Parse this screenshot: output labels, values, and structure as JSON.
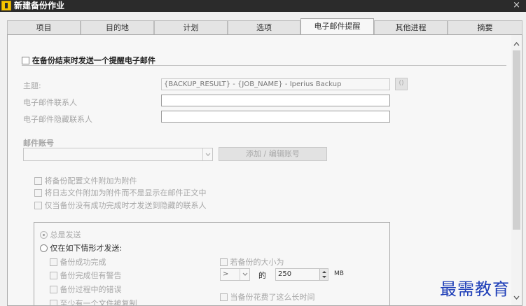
{
  "window": {
    "title": "新建备份作业",
    "close_glyph": "×"
  },
  "tabs": [
    "项目",
    "目的地",
    "计划",
    "选项",
    "电子邮件提醒",
    "其他进程",
    "摘要"
  ],
  "email": {
    "send_checkbox_label": "在备份结束时发送一个提醒电子邮件",
    "subject_label": "主题:",
    "subject_value": "{BACKUP_RESULT} - {JOB_NAME} - Iperius Backup",
    "subject_var_button": "()",
    "recipients_label": "电子邮件联系人",
    "recipients_value": "",
    "bcc_label": "电子邮件隐藏联系人",
    "bcc_value": "",
    "account_label": "邮件账号",
    "account_value": "",
    "add_account_button": "添加 / 编辑账号",
    "options": [
      "将备份配置文件附加为附件",
      "将日志文件附加为附件而不是显示在邮件正文中",
      "仅当备份没有成功完成时才发送到隐藏的联系人"
    ]
  },
  "conditions": {
    "always_send": "总是发送",
    "only_if": "仅在如下情形才发送:",
    "left": [
      "备份成功完成",
      "备份完成但有警告",
      "备份过程中的错误",
      "至少有一个文件被复制"
    ],
    "size_label": "若备份的大小为",
    "size_operator": ">",
    "size_of": "的",
    "size_value": "250",
    "size_unit": "MB",
    "time_label": "当备份花费了这么长时间"
  },
  "watermark": "最需教育",
  "icons": {
    "close": "close-icon",
    "dropdown": "chevron-down-icon",
    "scroll_up": "chevron-up-icon",
    "scroll_down": "chevron-down-icon",
    "spinner": "spinner-icon"
  }
}
